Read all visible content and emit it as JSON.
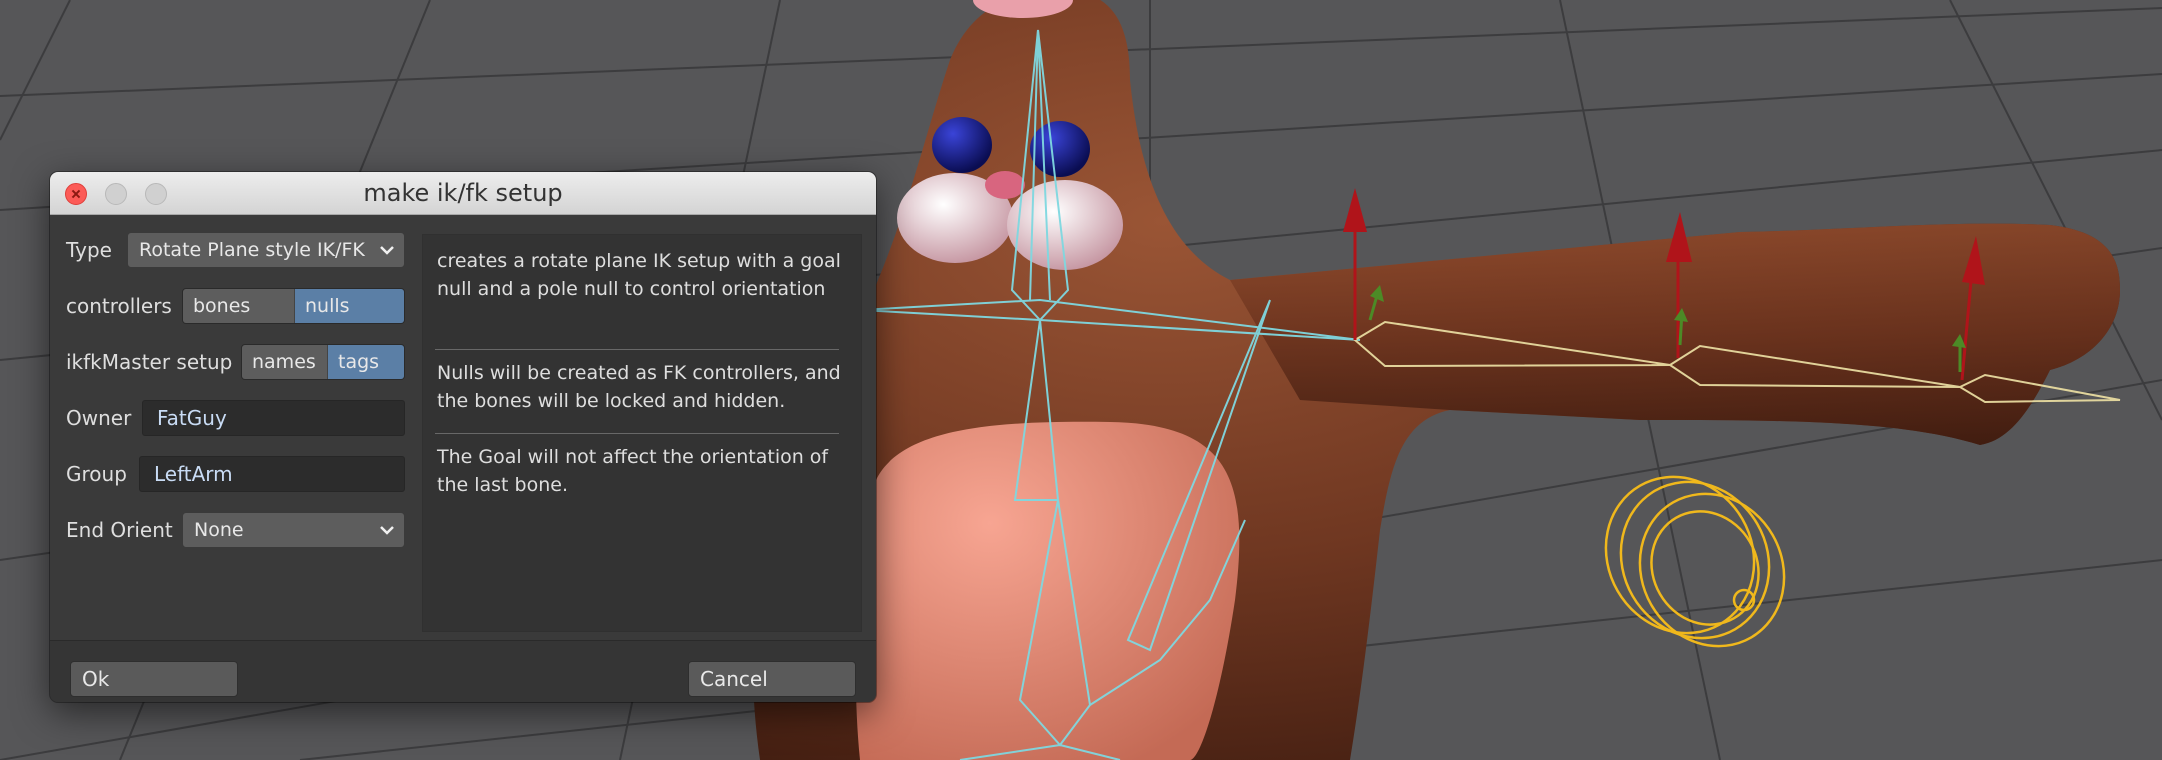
{
  "dialog": {
    "title": "make ik/fk setup",
    "type": {
      "label": "Type",
      "value": "Rotate Plane style IK/FK"
    },
    "controllers": {
      "label": "controllers",
      "options": [
        "bones",
        "nulls"
      ],
      "selected": "nulls"
    },
    "ikfk_master": {
      "label": "ikfkMaster setup",
      "options": [
        "names",
        "tags"
      ],
      "selected": "tags"
    },
    "owner": {
      "label": "Owner",
      "value": "FatGuy"
    },
    "group": {
      "label": "Group",
      "value": "LeftArm"
    },
    "end_orient": {
      "label": "End Orient",
      "value": "None"
    },
    "description": [
      "creates a rotate plane IK setup with a goal null and a pole null to control orientation",
      "Nulls will be created as FK controllers, and the bones will be locked and hidden.",
      "The Goal will not affect the orientation of the last bone."
    ],
    "ok_label": "Ok",
    "cancel_label": "Cancel"
  },
  "colors": {
    "accent": "#5b7fa6",
    "close_button": "#fc5b57",
    "bone_wire": "#7fd8e0",
    "controller_wire": "#f0b81c"
  }
}
